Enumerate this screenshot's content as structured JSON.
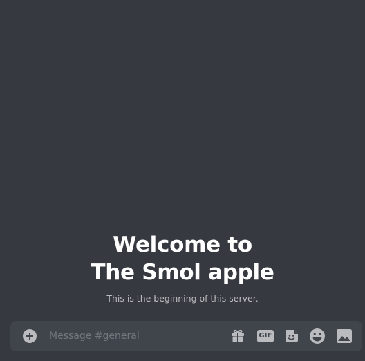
{
  "welcome": {
    "title_line1": "Welcome to",
    "title_line2": "The Smol apple",
    "subtitle": "This is the beginning of this server."
  },
  "composer": {
    "placeholder": "Message #general",
    "gif_label": "GIF"
  },
  "icons": {
    "attach": "plus-circle-icon",
    "gift": "gift-icon",
    "gif": "gif-icon",
    "sticker": "sticker-icon",
    "emoji": "emoji-icon",
    "image": "image-icon"
  },
  "colors": {
    "background": "#36393f",
    "composer": "#40444b",
    "icon": "#b9bbbe",
    "placeholder": "#72767d",
    "title": "#ffffff"
  }
}
